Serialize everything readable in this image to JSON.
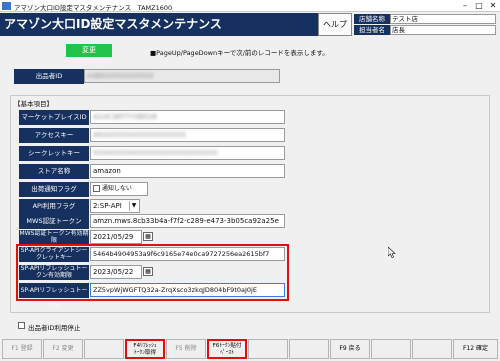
{
  "window": {
    "title": "アマゾン大口ID設定マスタメンテナンス　TAMZ1600",
    "controls": [
      "–",
      "□",
      "✕"
    ]
  },
  "header": {
    "title": "アマゾン大口ID設定マスタメンテナンス",
    "help_label": "ヘルプ"
  },
  "store": {
    "store_label": "店舗名称",
    "store_value": "テスト店",
    "staff_label": "担当者名",
    "staff_value": "店長"
  },
  "mode": {
    "label": "変更",
    "hint": "■PageUp/PageDownキーで次/前のレコードを表示します。"
  },
  "exhibitor": {
    "label": "出品者ID",
    "value": "A3BXXXXXXXXXXX"
  },
  "basic": {
    "section_label": "【基本項目】",
    "marketplace_label": "マーケットプレイスID",
    "marketplace_value": "A1VC38T7YXB528",
    "access_key_label": "アクセスキー",
    "access_key_value": "AKIAXXXXXXXXXXXXXXXX",
    "secret_key_label": "シークレットキー",
    "secret_key_value": "XXXXXXXXXXXXXXXXXXXXXXXXXX",
    "store_name_label": "ストア名称",
    "store_name_value": "amazon",
    "ship_flag_label": "出荷通知フラグ",
    "ship_flag_value": "通知しない",
    "api_flag_label": "API利用フラグ",
    "api_flag_value": "2:SP-API",
    "mws_token_label": "MWS認証トークン",
    "mws_token_value": "amzn.mws.8cb33b4a-f7f2-c289-e473-3b05ca92a25e",
    "mws_expiry_label": "MWS認証トークン有効期限",
    "mws_expiry_value": "2021/05/29",
    "client_secret_label": "SP-APIクライアントシークレットキー",
    "client_secret_value": "5464b4904953a9f6c9165e74e0ca9727256ea2615bf7",
    "refresh_expiry_label": "SP-APIリフレッシュトークン有効期限",
    "refresh_expiry_value": "2023/05/22",
    "refresh_token_label": "SP-APIリフレッシュトークン",
    "refresh_token_value": "ZZ5vpWjWGFTQ32a-ZrqXsco3zkqJD804bF9t0aJ0jE"
  },
  "stop": {
    "label": "出品者ID利用停止"
  },
  "fkeys": {
    "f1": "F1 登録",
    "f2": "F2 変更",
    "f4_a": "F4ﾘﾌﾚｯｼｭ",
    "f4_b": "ﾄｰｸﾝ取得",
    "f5": "F5 削除",
    "f6_a": "F6ﾄｰｸﾝ貼付",
    "f6_b": "ﾍﾟｰｽﾄ",
    "f9": "F9 戻る",
    "f12": "F12 確定"
  },
  "icons": {
    "calendar": "calendar-icon",
    "dropdown": "chevron-down-icon"
  }
}
